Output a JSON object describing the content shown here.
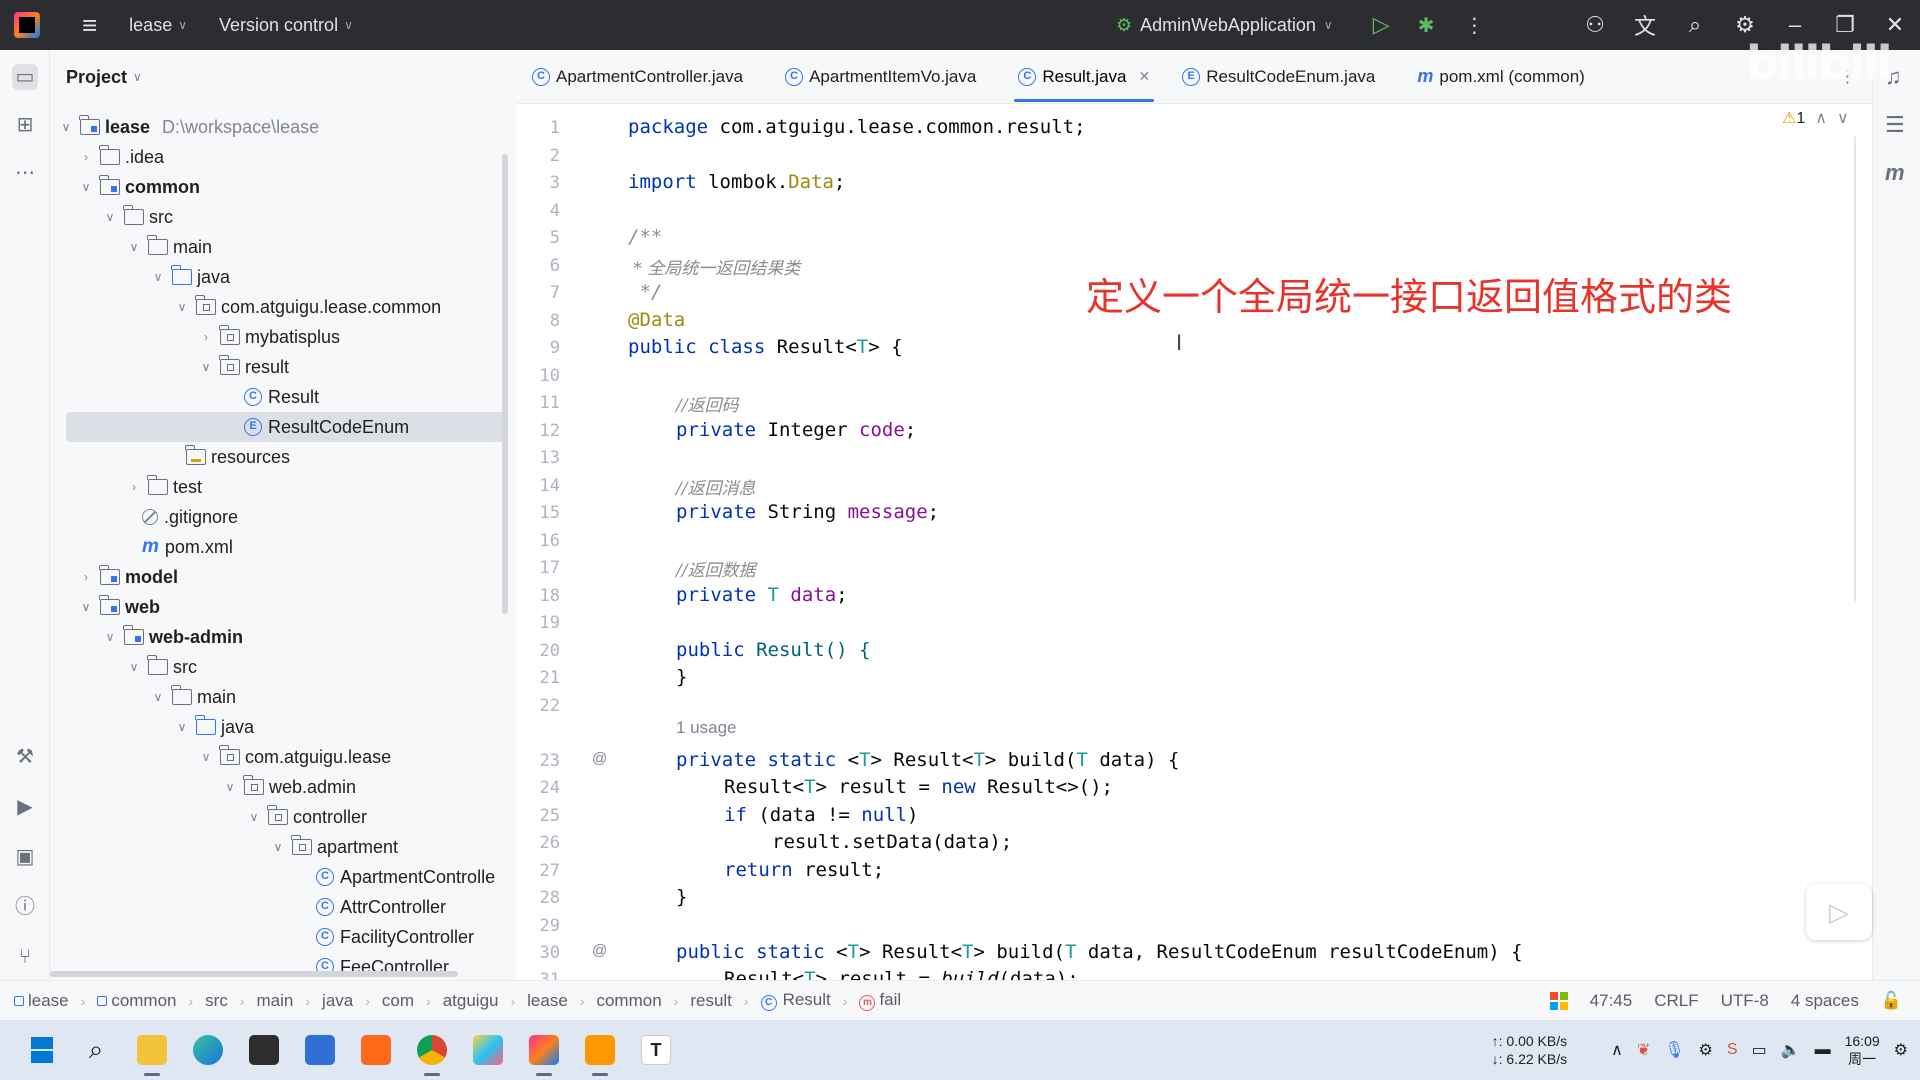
{
  "titlebar": {
    "project_name": "lease",
    "vcs_label": "Version control",
    "run_config": "AdminWebApplication"
  },
  "project_panel": {
    "title": "Project",
    "tree": [
      {
        "label": "lease",
        "path": "D:\\workspace\\lease"
      },
      {
        "label": ".idea"
      },
      {
        "label": "common"
      },
      {
        "label": "src"
      },
      {
        "label": "main"
      },
      {
        "label": "java"
      },
      {
        "label": "com.atguigu.lease.common"
      },
      {
        "label": "mybatisplus"
      },
      {
        "label": "result"
      },
      {
        "label": "Result"
      },
      {
        "label": "ResultCodeEnum"
      },
      {
        "label": "resources"
      },
      {
        "label": "test"
      },
      {
        "label": ".gitignore"
      },
      {
        "label": "pom.xml"
      },
      {
        "label": "model"
      },
      {
        "label": "web"
      },
      {
        "label": "web-admin"
      },
      {
        "label": "src"
      },
      {
        "label": "main"
      },
      {
        "label": "java"
      },
      {
        "label": "com.atguigu.lease"
      },
      {
        "label": "web.admin"
      },
      {
        "label": "controller"
      },
      {
        "label": "apartment"
      },
      {
        "label": "ApartmentControlle"
      },
      {
        "label": "AttrController"
      },
      {
        "label": "FacilityController"
      },
      {
        "label": "FeeController"
      }
    ]
  },
  "tabs": [
    {
      "label": "ApartmentController.java"
    },
    {
      "label": "ApartmentItemVo.java"
    },
    {
      "label": "Result.java"
    },
    {
      "label": "ResultCodeEnum.java"
    },
    {
      "label": "pom.xml (common)"
    }
  ],
  "editor": {
    "warning_count": "1",
    "overlay_text": "定义一个全局统一接口返回值格式的类",
    "line_numbers": [
      "1",
      "2",
      "3",
      "4",
      "5",
      "6",
      "7",
      "8",
      "9",
      "10",
      "11",
      "12",
      "13",
      "14",
      "15",
      "16",
      "17",
      "18",
      "19",
      "20",
      "21",
      "22",
      "23",
      "24",
      "25",
      "26",
      "27",
      "28",
      "29",
      "30",
      "31"
    ],
    "usage_hint": "1 usage",
    "code": {
      "l1_kw": "package",
      "l1_rest": " com.atguigu.lease.common.result;",
      "l3_kw": "import",
      "l3_mid": " lombok.",
      "l3_type": "Data",
      "l3_end": ";",
      "l5": "/**",
      "l6": " * 全局统一返回结果类",
      "l7": " */",
      "l8": "@Data",
      "l9_kw": "public class",
      "l9_name": " Result<",
      "l9_t": "T",
      "l9_end": "> {",
      "l11": "//返回码",
      "l12_kw": "private",
      "l12_type": " Integer ",
      "l12_fd": "code",
      "l12_end": ";",
      "l14": "//返回消息",
      "l15_kw": "private",
      "l15_type": " String ",
      "l15_fd": "message",
      "l15_end": ";",
      "l17": "//返回数据",
      "l18_kw": "private",
      "l18_t": " T ",
      "l18_fd": "data",
      "l18_end": ";",
      "l20_kw": "public",
      "l20_rest": " Result() {",
      "l21": "}",
      "l23_kw": "private static",
      "l23_a": " <",
      "l23_t1": "T",
      "l23_b": "> Result<",
      "l23_t2": "T",
      "l23_c": "> build(",
      "l23_t3": "T",
      "l23_d": " data) {",
      "l24_a": "Result<",
      "l24_t": "T",
      "l24_b": "> result = ",
      "l24_kw": "new",
      "l24_c": " Result<>();",
      "l25_kw": "if",
      "l25_a": " (data != ",
      "l25_kw2": "null",
      "l25_b": ")",
      "l26": "result.setData(data);",
      "l27_kw": "return",
      "l27_rest": " result;",
      "l28": "}",
      "l30_kw": "public static",
      "l30_a": " <",
      "l30_t1": "T",
      "l30_b": "> Result<",
      "l30_t2": "T",
      "l30_c": "> build(",
      "l30_t3": "T",
      "l30_d": " data, ResultCodeEnum resultCodeEnum) {",
      "l31_a": "Result<",
      "l31_t": "T",
      "l31_b": "> result = ",
      "l31_it": "build",
      "l31_c": "(data);"
    }
  },
  "statusbar": {
    "breadcrumbs": [
      "lease",
      "common",
      "src",
      "main",
      "java",
      "com",
      "atguigu",
      "lease",
      "common",
      "result",
      "Result",
      "fail"
    ],
    "position": "47:45",
    "line_sep": "CRLF",
    "encoding": "UTF-8",
    "indent": "4 spaces"
  },
  "taskbar": {
    "net_up": "↑: 0.00 KB/s",
    "net_down": "↓: 6.22 KB/s",
    "time": "16:09",
    "day": "周一"
  },
  "watermark": "bilibili",
  "colors": {
    "accent": "#3574f0",
    "overlay_red": "#e8332a",
    "keyword": "#0033b3",
    "field": "#871094",
    "annotation": "#9e880d",
    "comment": "#8c8c8c"
  }
}
